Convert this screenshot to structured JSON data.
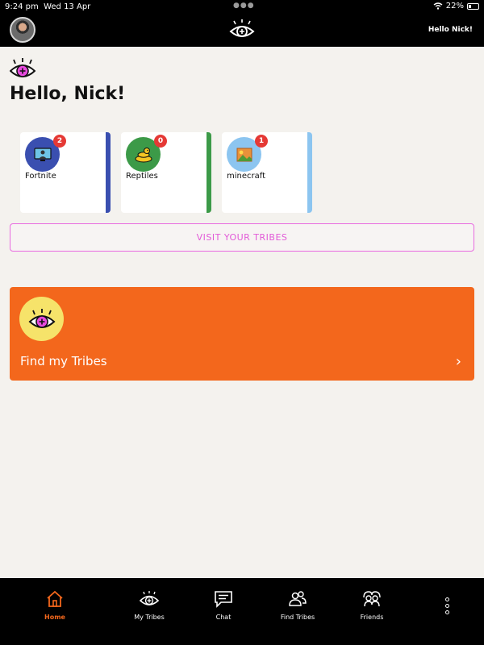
{
  "status": {
    "time": "9:24 pm",
    "date": "Wed 13 Apr",
    "battery": "22%"
  },
  "header": {
    "greeting": "Hello Nick!"
  },
  "main": {
    "title": "Hello, Nick!",
    "tribes": [
      {
        "name": "Fortnite",
        "count": "2",
        "color": "#3a4fb0",
        "icon_bg": "#3a4fb0",
        "icon": "computer-user-icon"
      },
      {
        "name": "Reptiles",
        "count": "0",
        "color": "#3c9a48",
        "icon_bg": "#3c9a48",
        "icon": "snake-icon"
      },
      {
        "name": "minecraft",
        "count": "1",
        "color": "#8cc5f0",
        "icon_bg": "#8cc5f0",
        "icon": "landscape-icon"
      }
    ],
    "visit_label": "VISIT YOUR TRIBES",
    "find_label": "Find my Tribes"
  },
  "nav": {
    "items": [
      {
        "label": "Home",
        "icon": "home-icon",
        "active": true
      },
      {
        "label": "My Tribes",
        "icon": "eye-icon"
      },
      {
        "label": "Chat",
        "icon": "chat-icon"
      },
      {
        "label": "Find Tribes",
        "icon": "people-icon"
      },
      {
        "label": "Friends",
        "icon": "friends-icon"
      }
    ]
  },
  "colors": {
    "accent_orange": "#f3671c",
    "accent_pink": "#e25ad8",
    "background": "#f4f2ee"
  }
}
